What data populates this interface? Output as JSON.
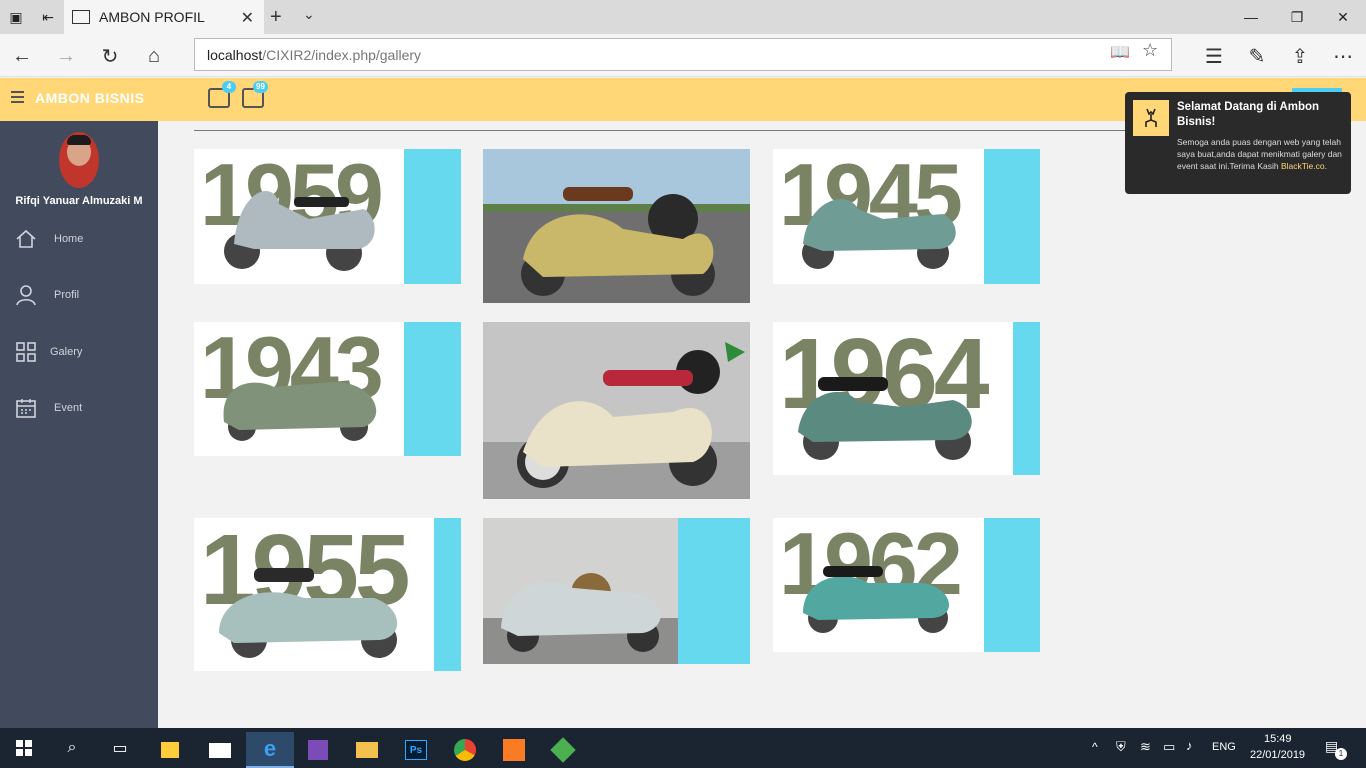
{
  "browser": {
    "tab_title": "AMBON PROFIL",
    "url_host": "localhost",
    "url_path": "/CIXIR2/index.php/gallery"
  },
  "header": {
    "brand": "AMBON BISNIS",
    "tasks_badge": "4",
    "mail_badge": "99"
  },
  "sidebar": {
    "user_name": "Rifqi Yanuar Almuzaki M",
    "items": [
      {
        "label": "Home",
        "icon": "home-icon"
      },
      {
        "label": "Profil",
        "icon": "user-icon"
      },
      {
        "label": "Galery",
        "icon": "grid-icon"
      },
      {
        "label": "Event",
        "icon": "calendar-icon"
      }
    ]
  },
  "gallery": {
    "items": [
      {
        "year": "1959",
        "color": "#aeb9c0"
      },
      {
        "year": "",
        "color": "#c9b86a"
      },
      {
        "year": "1945",
        "color": "#6f9c95"
      },
      {
        "year": "1943",
        "color": "#80937a"
      },
      {
        "year": "",
        "color": "#e9e1c8"
      },
      {
        "year": "1964",
        "color": "#5a8a80"
      },
      {
        "year": "1955",
        "color": "#a8c0bd"
      },
      {
        "year": "",
        "color": "#cfd6d8"
      },
      {
        "year": "1962",
        "color": "#52a7a0"
      }
    ]
  },
  "toast": {
    "title": "Selamat Datang di Ambon Bisnis!",
    "message": "Semoga anda puas dengan web yang telah saya buat,anda dapat menikmati galery dan event saat ini.Terima Kasih",
    "link": "BlackTie.co",
    "link_suffix": "."
  },
  "taskbar": {
    "language": "ENG",
    "time": "15:49",
    "date": "22/01/2019",
    "notif_count": "1"
  },
  "colors": {
    "accent": "#ffd777",
    "sidebar": "#424a5d",
    "card_bg": "#66d9ef"
  }
}
